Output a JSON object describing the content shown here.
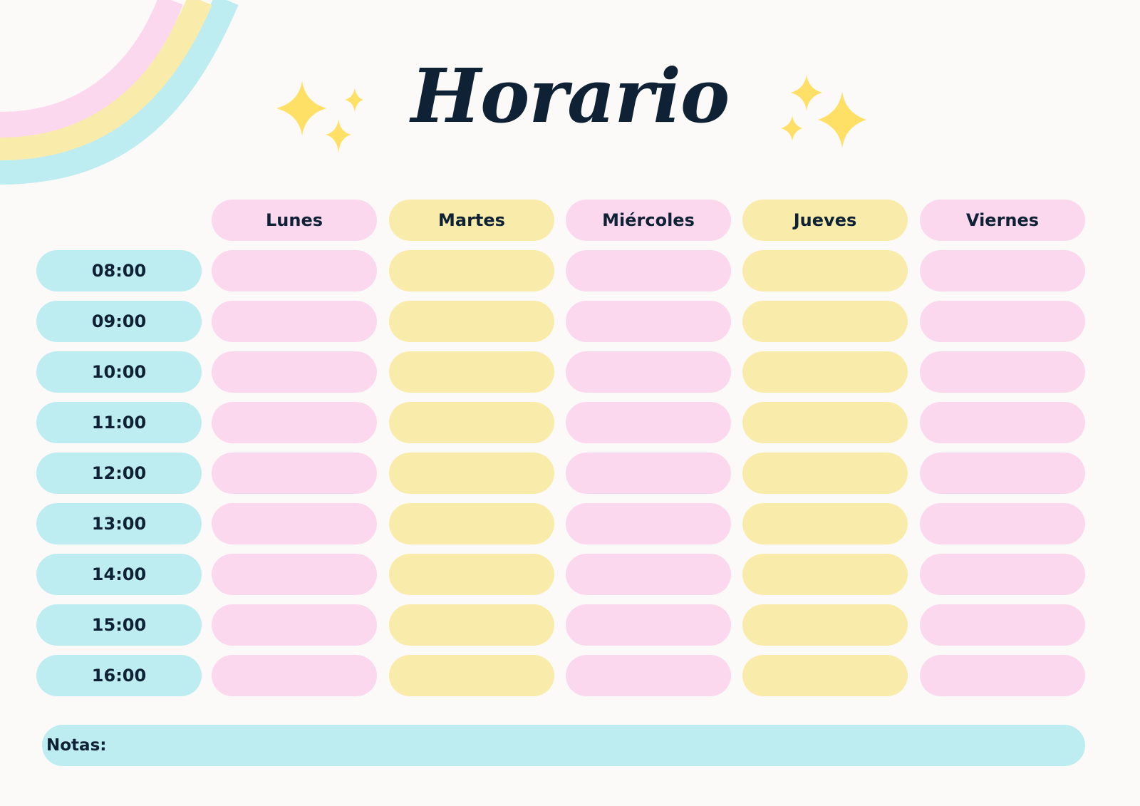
{
  "title": "Horario",
  "days": [
    "Lunes",
    "Martes",
    "Miércoles",
    "Jueves",
    "Viernes"
  ],
  "times": [
    "08:00",
    "09:00",
    "10:00",
    "11:00",
    "12:00",
    "13:00",
    "14:00",
    "15:00",
    "16:00"
  ],
  "notes_label": "Notas:",
  "colors": {
    "background": "#fcfaf8",
    "pink": "#fcd8ee",
    "yellow": "#f9ecab",
    "blue": "#bdedf1",
    "text": "#0f2235",
    "sparkle": "#ffe066"
  },
  "decorations": [
    "rainbow-decoration",
    "sparkles-icon"
  ]
}
